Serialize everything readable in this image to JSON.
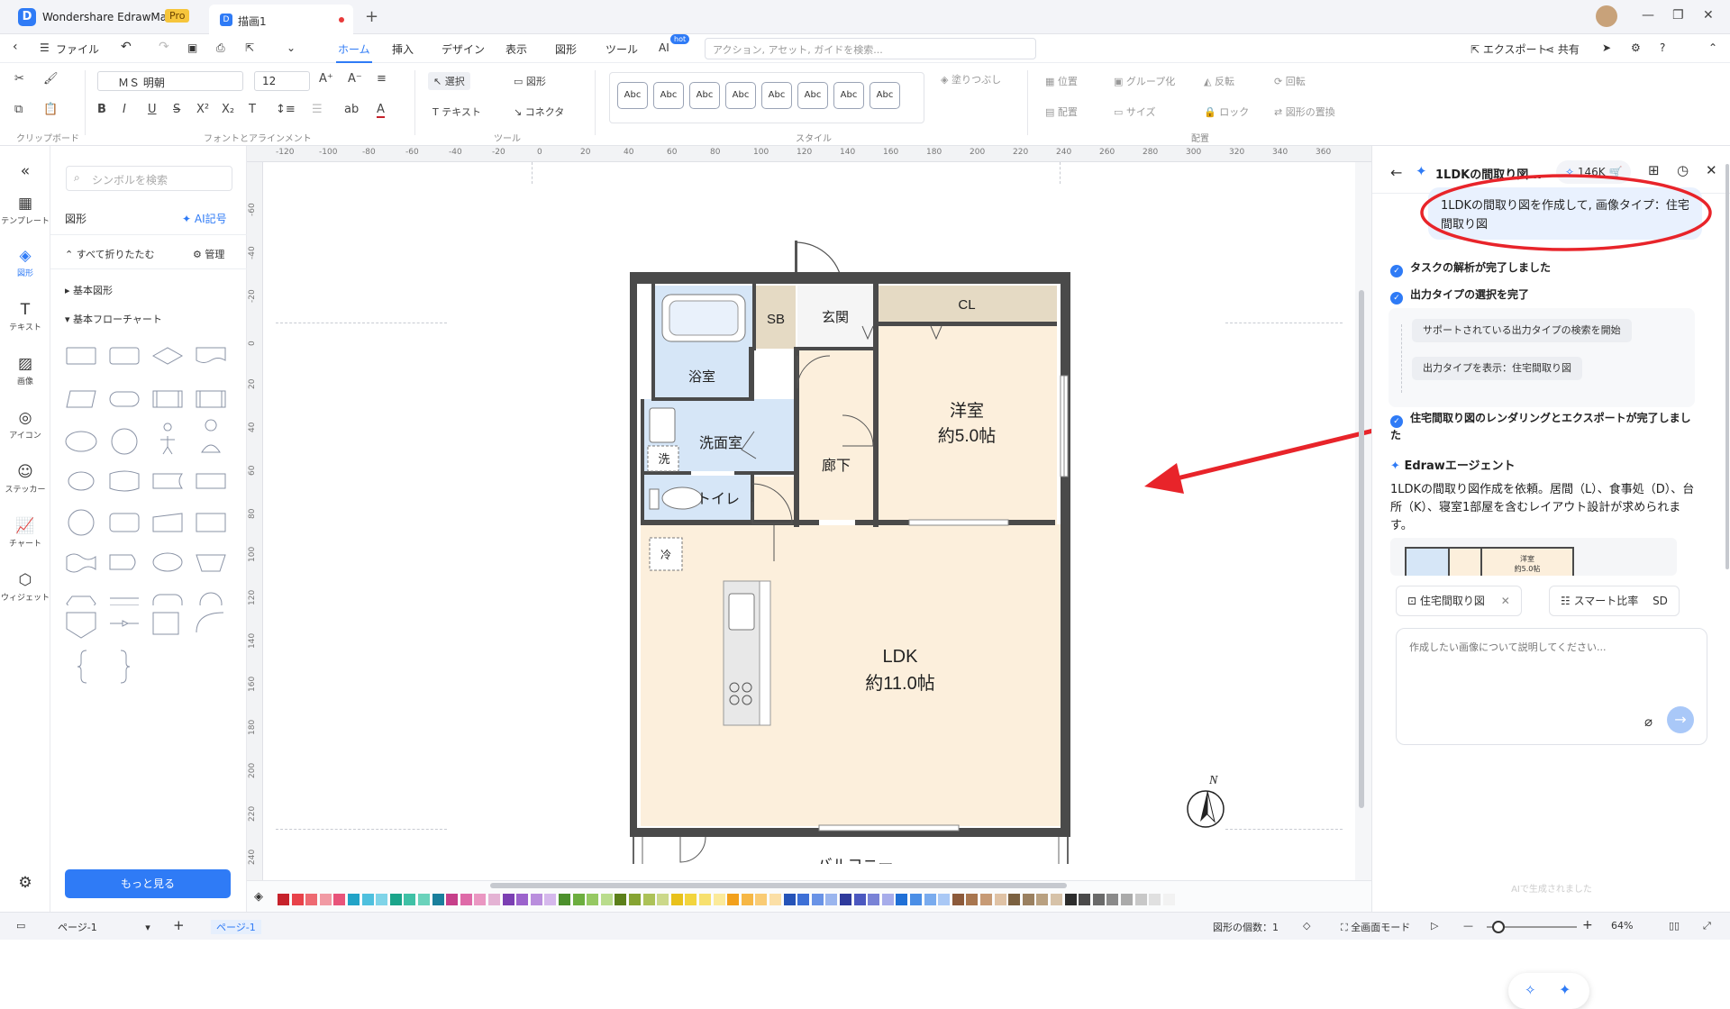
{
  "app": {
    "name": "Wondershare EdrawMax",
    "badge": "Pro",
    "doc_tab": "描画1"
  },
  "menu": {
    "file": "ファイル",
    "tabs": [
      "ホーム",
      "挿入",
      "デザイン",
      "表示",
      "図形",
      "ツール",
      "AI"
    ],
    "ai_badge": "hot",
    "search_placeholder": "アクション, アセット, ガイドを検索...",
    "export": "エクスポート",
    "share": "共有"
  },
  "ribbon": {
    "font": "ＭＳ 明朝",
    "size": "12",
    "select": "選択",
    "shape": "図形",
    "text": "テキスト",
    "connector": "コネクタ",
    "style_sample": "Abc",
    "fill": "塗りつぶし",
    "position": "位置",
    "group": "グループ化",
    "rotate_flip": "反転",
    "rotate": "回転",
    "align": "配置",
    "size_btn": "サイズ",
    "lock": "ロック",
    "replace": "図形の置換",
    "groups": {
      "clipboard": "クリップボード",
      "font": "フォントとアラインメント",
      "tools": "ツール",
      "style": "スタイル",
      "arrange": "配置"
    }
  },
  "sidebar": {
    "items": [
      "テンプレート",
      "図形",
      "テキスト",
      "画像",
      "アイコン",
      "ステッカー",
      "チャート",
      "ウィジェット"
    ]
  },
  "library": {
    "search_placeholder": "シンボルを検索",
    "title": "図形",
    "ai_symbol": "AI記号",
    "collapse_all": "すべて折りたたむ",
    "manage": "管理",
    "sections": [
      "基本図形",
      "基本フローチャート"
    ],
    "more": "もっと見る"
  },
  "ruler": {
    "h": [
      "-120",
      "-100",
      "-80",
      "-60",
      "-40",
      "-20",
      "0",
      "20",
      "40",
      "60",
      "80",
      "100",
      "120",
      "140",
      "160",
      "180",
      "200",
      "220",
      "240",
      "260",
      "280",
      "300",
      "320",
      "340",
      "360"
    ],
    "v": [
      "-60",
      "-40",
      "-20",
      "0",
      "20",
      "40",
      "60",
      "80",
      "100",
      "120",
      "140",
      "160",
      "180",
      "200",
      "220",
      "240"
    ]
  },
  "floorplan": {
    "rooms": {
      "sb": "SB",
      "entrance": "玄関",
      "cl": "CL",
      "bath": "浴室",
      "western": "洋室",
      "western_size": "約5.0帖",
      "washroom": "洗面室",
      "wash": "洗",
      "hall": "廊下",
      "toilet": "トイレ",
      "fridge": "冷",
      "ldk": "LDK",
      "ldk_size": "約11.0帖",
      "balcony": "バルコニー"
    },
    "north": "N"
  },
  "colors": {
    "accent": "#2f7bf6",
    "wall": "#4a4a4a",
    "bath": "#d6e6f7",
    "wood": "#fcefdc",
    "closet": "#e5dac4",
    "annotation": "#e8242a"
  },
  "palette": [
    "#c6222b",
    "#e8424a",
    "#ee6a72",
    "#f19aa4",
    "#e8547a",
    "#21a3c7",
    "#4fc0de",
    "#7fd4e8",
    "#1aa48a",
    "#3fc1a6",
    "#6ad2bb",
    "#1a7f9c",
    "#c63f8a",
    "#de6aa8",
    "#ea97c2",
    "#e4b3d4",
    "#7b3fb3",
    "#9b62cc",
    "#b98edd",
    "#d5b8ec",
    "#4b8f2c",
    "#6cae3f",
    "#95c862",
    "#b9dc8c",
    "#5b7f1a",
    "#85a332",
    "#acc258",
    "#cbd88a",
    "#e8c11b",
    "#f2d43d",
    "#f7e06e",
    "#fbea9a",
    "#f2a01b",
    "#f6b745",
    "#f9cb74",
    "#fbdfa6",
    "#2553b8",
    "#3c6fd6",
    "#6993e6",
    "#9ab5ee",
    "#2e3a9c",
    "#4b58c0",
    "#7882d6",
    "#a6acea",
    "#1f6fd6",
    "#4a8ee6",
    "#79abee",
    "#a9c8f5",
    "#8c5a3a",
    "#a8764f",
    "#c69a75",
    "#dfc2a5",
    "#7a6040",
    "#9a8060",
    "#b8a080",
    "#d6c2a8",
    "#2c2c2c",
    "#4a4a4a",
    "#6a6a6a",
    "#8a8a8a",
    "#aaaaaa",
    "#c8c8c8",
    "#e0e0e0",
    "#f2f2f2"
  ],
  "aipanel": {
    "title": "1LDKの間取り図...",
    "credits": "146K",
    "prompt": "1LDKの間取り図を作成して, 画像タイプ：住宅間取り図",
    "steps": [
      "タスクの解析が完了しました",
      "出力タイプの選択を完了",
      "住宅間取り図のレンダリングとエクスポートが完了しました"
    ],
    "substeps": [
      "サポートされている出力タイプの検索を開始",
      "出力タイプを表示：住宅間取り図"
    ],
    "agent": "Edrawエージェント",
    "agent_msg": "1LDKの間取り図作成を依頼。居間（L）、食事処（D）、台所（K）、寝室1部屋を含むレイアウト設計が求められます。",
    "thumb_text": "洋室\n約5.0帖",
    "chip1": "住宅間取り図",
    "chip2": "スマート比率",
    "chip2_val": "SD",
    "input_placeholder": "作成したい画像について説明してください...",
    "footnote": "AIで生成されました"
  },
  "status": {
    "page_sel": "ページ-1",
    "page_tab": "ページ-1",
    "shape_count": "図形の個数：1",
    "fullscreen": "全画面モード",
    "zoom": "64%"
  }
}
